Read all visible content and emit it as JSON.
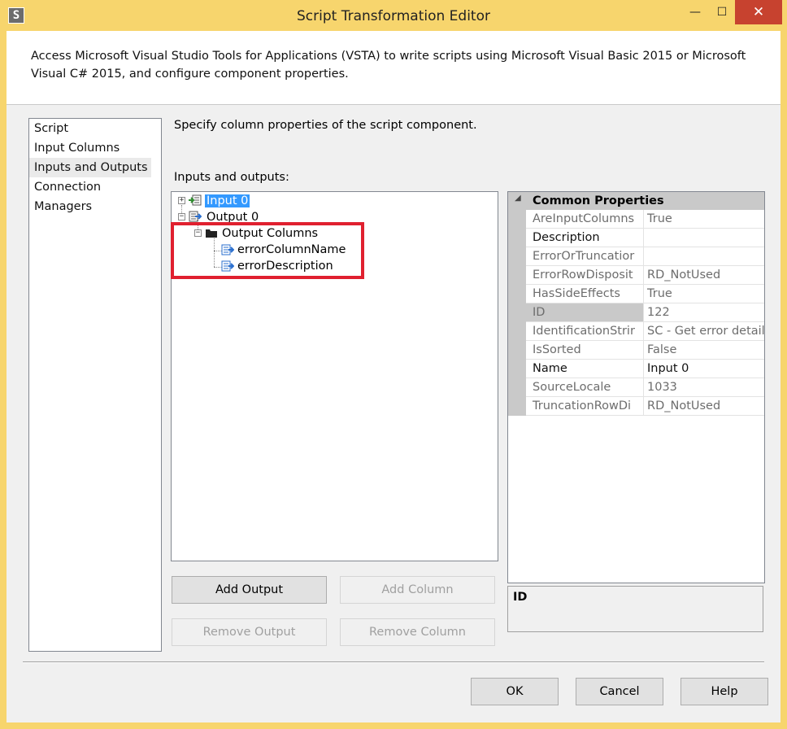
{
  "window": {
    "title": "Script Transformation Editor",
    "minimize_glyph": "—",
    "maximize_glyph": "☐",
    "close_glyph": "✕"
  },
  "header": {
    "description": "Access Microsoft Visual Studio Tools for Applications (VSTA) to write scripts using Microsoft Visual Basic 2015 or Microsoft Visual C# 2015, and configure component properties."
  },
  "nav": {
    "items": [
      {
        "label": "Script",
        "selected": false
      },
      {
        "label": "Input Columns",
        "selected": false
      },
      {
        "label": "Inputs and Outputs",
        "selected": true
      },
      {
        "label": "Connection Managers",
        "selected": false
      }
    ]
  },
  "main": {
    "instruction": "Specify column properties of the script component.",
    "io_label": "Inputs and outputs:",
    "tree": {
      "input0": "Input 0",
      "output0": "Output 0",
      "output_columns": "Output Columns",
      "columns": [
        "errorColumnName",
        "errorDescription"
      ]
    },
    "buttons": {
      "add_output": "Add Output",
      "add_column": "Add Column",
      "remove_output": "Remove Output",
      "remove_column": "Remove Column"
    }
  },
  "properties": {
    "category": "Common Properties",
    "rows": [
      {
        "name": "AreInputColumns",
        "value": "True",
        "editable": false
      },
      {
        "name": "Description",
        "value": "",
        "editable": true
      },
      {
        "name": "ErrorOrTruncatior",
        "value": "",
        "editable": false
      },
      {
        "name": "ErrorRowDisposit",
        "value": "RD_NotUsed",
        "editable": false
      },
      {
        "name": "HasSideEffects",
        "value": "True",
        "editable": false
      },
      {
        "name": "ID",
        "value": "122",
        "editable": false
      },
      {
        "name": "IdentificationStrir",
        "value": "SC - Get error details.Inpu",
        "editable": false
      },
      {
        "name": "IsSorted",
        "value": "False",
        "editable": false
      },
      {
        "name": "Name",
        "value": "Input 0",
        "editable": true
      },
      {
        "name": "SourceLocale",
        "value": "1033",
        "editable": false
      },
      {
        "name": "TruncationRowDi",
        "value": "RD_NotUsed",
        "editable": false
      }
    ],
    "selected_property": "ID",
    "description_title": "ID"
  },
  "footer": {
    "ok": "OK",
    "cancel": "Cancel",
    "help": "Help"
  },
  "colors": {
    "title_bar": "#f7d56d",
    "close_button": "#c7422f",
    "selection": "#3399ff",
    "highlight_box": "#e0202f"
  }
}
